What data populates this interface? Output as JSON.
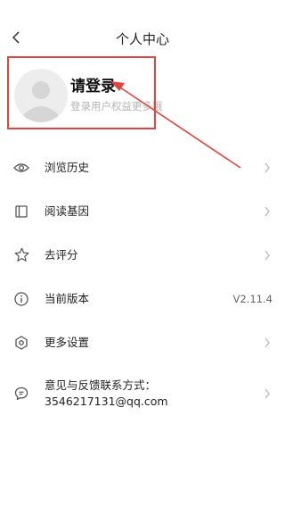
{
  "header": {
    "title": "个人中心",
    "back_icon": "chevron-left-icon"
  },
  "profile": {
    "title": "请登录",
    "subtitle": "登录用户权益更多哦"
  },
  "menu": {
    "items": [
      {
        "label": "浏览历史",
        "icon": "eye-icon"
      },
      {
        "label": "阅读基因",
        "icon": "book-icon"
      },
      {
        "label": "去评分",
        "icon": "star-icon"
      },
      {
        "label": "当前版本",
        "icon": "info-icon",
        "value": "V2.11.4"
      },
      {
        "label": "更多设置",
        "icon": "settings-icon"
      },
      {
        "label": "意见与反馈联系方式：3546217131@qq.com",
        "icon": "chat-icon"
      }
    ]
  },
  "colors": {
    "annotation": "#e0463f",
    "icon": "#555555",
    "chevron": "#bbbbbb"
  }
}
